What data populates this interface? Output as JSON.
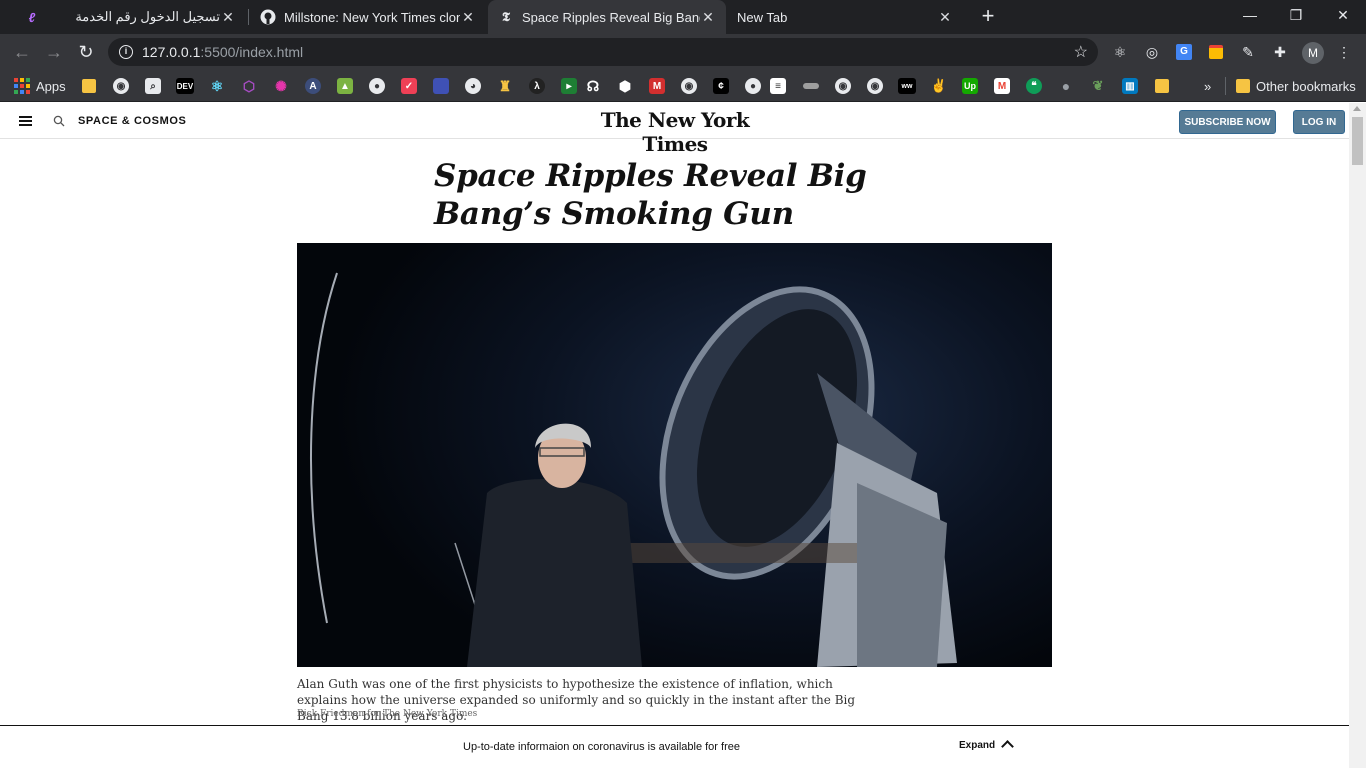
{
  "browser": {
    "tabs": [
      {
        "title": "تسجيل الدخول رقم الخدمة",
        "favicon": "purple-swirl-icon",
        "active": false
      },
      {
        "title": "Millstone: New York Times clone",
        "favicon": "github-icon",
        "active": false
      },
      {
        "title": "Space Ripples Reveal Big Bang's S",
        "favicon": "nyt-t-icon",
        "active": true
      },
      {
        "title": "New Tab",
        "favicon": "",
        "active": false
      }
    ],
    "url_host": "127.0.0.1",
    "url_path": ":5500/index.html",
    "profile_initial": "M",
    "bookmarks": {
      "apps_label": "Apps",
      "dev_label": "DEV",
      "overflow_label": "»",
      "other_label": "Other bookmarks"
    }
  },
  "page": {
    "section_label": "SPACE & COSMOS",
    "logo": "The New York Times",
    "subscribe_label": "SUBSCRIBE NOW",
    "login_label": "LOG IN",
    "headline": "Space Ripples Reveal Big Bang’s Smoking Gun",
    "caption": "Alan Guth was one of the first physicists to hypothesize the existence of inflation, which explains how the universe expanded so uniformly and so quickly in the instant after the Big Bang 13.8 billion years ago.",
    "credit": "Rick Friedman for The New York Times",
    "banner_message": "Up-to-date informaion on coronavirus is available for free",
    "banner_expand": "Expand"
  },
  "colors": {
    "chrome_dark": "#202124",
    "chrome_toolbar": "#35363a",
    "button_blue": "#567b95",
    "text": "#121212"
  }
}
